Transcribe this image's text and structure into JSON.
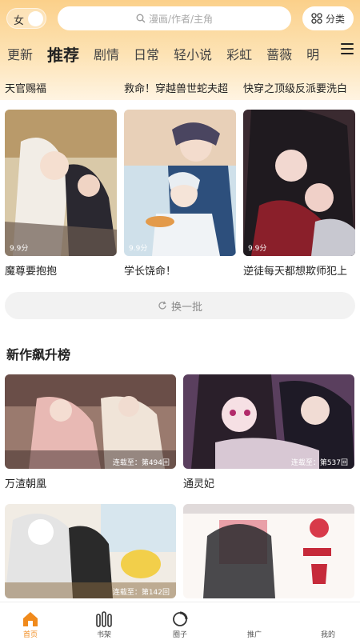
{
  "header": {
    "gender_label": "女",
    "search_placeholder": "漫画/作者/主角",
    "category_label": "分类",
    "tabs": [
      "更新",
      "推荐",
      "剧情",
      "日常",
      "轻小说",
      "彩虹",
      "蔷薇",
      "明"
    ],
    "active_tab": "推荐"
  },
  "top_row_titles": [
    "天官赐福",
    "救命！穿越兽世蛇夫超",
    "快穿之顶级反派要洗白"
  ],
  "recommended": [
    {
      "title": "魔尊要抱抱",
      "score": "9.9分"
    },
    {
      "title": "学长饶命！",
      "score": "9.9分"
    },
    {
      "title": "逆徒每天都想欺师犯上",
      "score": "9.9分"
    }
  ],
  "refresh_label": "换一批",
  "section_title": "新作飙升榜",
  "rising": [
    {
      "title": "万渣朝凰",
      "badge": "连载至：第494回"
    },
    {
      "title": "通灵妃",
      "badge": "连载至：第537回"
    },
    {
      "title": "",
      "badge": "连载至：第142回"
    },
    {
      "title": "",
      "badge": ""
    }
  ],
  "nav": [
    {
      "label": "首页",
      "icon": "home-icon"
    },
    {
      "label": "书架",
      "icon": "bookshelf-icon"
    },
    {
      "label": "圈子",
      "icon": "circle-icon"
    },
    {
      "label": "推广",
      "icon": "promote-icon"
    },
    {
      "label": "我的",
      "icon": "profile-icon"
    }
  ],
  "colors": {
    "accent": "#f08a1c",
    "header_top": "#fbd08a"
  }
}
